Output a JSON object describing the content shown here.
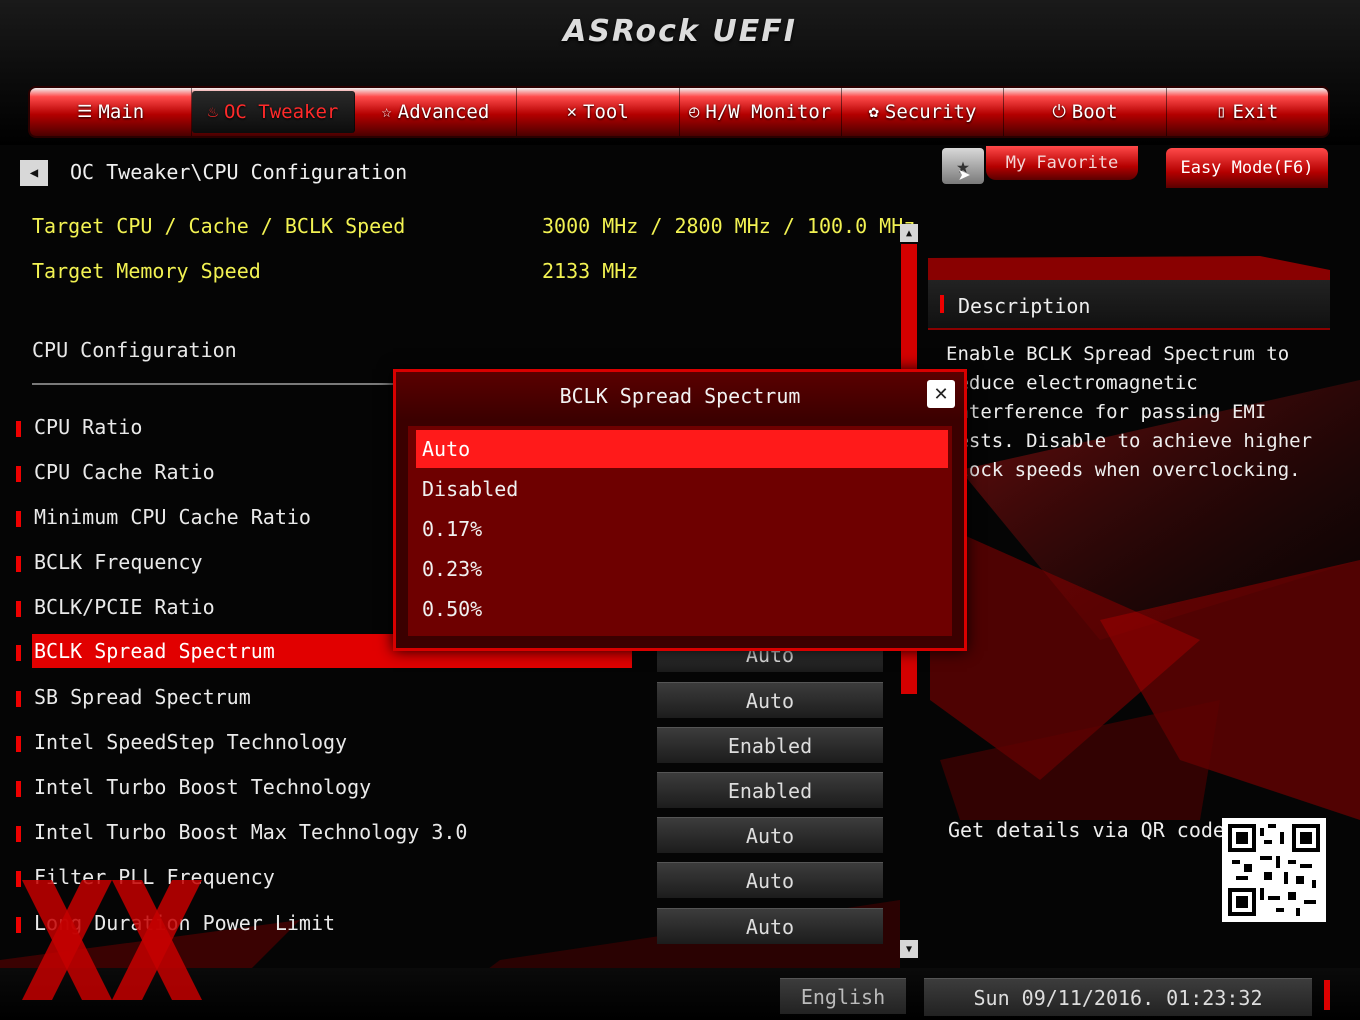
{
  "header": {
    "logo": "ASRock UEFI"
  },
  "tabs": [
    {
      "label": "Main",
      "icon": "list-icon",
      "active": false
    },
    {
      "label": "OC Tweaker",
      "icon": "flame-icon",
      "active": true
    },
    {
      "label": "Advanced",
      "icon": "star-icon",
      "active": false
    },
    {
      "label": "Tool",
      "icon": "tools-icon",
      "active": false
    },
    {
      "label": "H/W Monitor",
      "icon": "monitor-icon",
      "active": false
    },
    {
      "label": "Security",
      "icon": "shield-icon",
      "active": false
    },
    {
      "label": "Boot",
      "icon": "power-icon",
      "active": false
    },
    {
      "label": "Exit",
      "icon": "exit-icon",
      "active": false
    }
  ],
  "breadcrumb": "OC Tweaker\\CPU Configuration",
  "toolbar": {
    "favorite_label": "My Favorite",
    "easy_mode_label": "Easy Mode(F6)"
  },
  "info": [
    {
      "label": "Target CPU / Cache / BCLK Speed",
      "value": "3000 MHz / 2800 MHz / 100.0 MHz"
    },
    {
      "label": "Target Memory Speed",
      "value": "2133 MHz"
    }
  ],
  "section_title": "CPU Configuration",
  "settings": [
    {
      "label": "CPU Ratio",
      "value": ""
    },
    {
      "label": "CPU Cache Ratio",
      "value": ""
    },
    {
      "label": "Minimum CPU Cache Ratio",
      "value": ""
    },
    {
      "label": "BCLK Frequency",
      "value": ""
    },
    {
      "label": "BCLK/PCIE Ratio",
      "value": ""
    },
    {
      "label": "BCLK Spread Spectrum",
      "value": "Auto",
      "selected": true
    },
    {
      "label": "SB Spread Spectrum",
      "value": "Auto"
    },
    {
      "label": "Intel SpeedStep Technology",
      "value": "Enabled"
    },
    {
      "label": "Intel Turbo Boost Technology",
      "value": "Enabled"
    },
    {
      "label": "Intel Turbo Boost Max Technology 3.0",
      "value": "Auto"
    },
    {
      "label": "Filter PLL Frequency",
      "value": "Auto"
    },
    {
      "label": "Long Duration Power Limit",
      "value": "Auto"
    }
  ],
  "description": {
    "title": "Description",
    "text": "Enable BCLK Spread Spectrum to\nreduce electromagnetic\ninterference for passing EMI\ntests. Disable to achieve higher\nclock speeds when overclocking.",
    "qr_label": "Get details via QR code"
  },
  "popup": {
    "title": "BCLK Spread Spectrum",
    "close_icon": "close-icon",
    "options": [
      "Auto",
      "Disabled",
      "0.17%",
      "0.23%",
      "0.50%"
    ],
    "selected": "Auto"
  },
  "footer": {
    "language": "English",
    "datetime": "Sun 09/11/2016. 01:23:32"
  },
  "colors": {
    "accent": "#e10000",
    "info_text": "#f2f252",
    "popup_bg": "#6e0000"
  }
}
